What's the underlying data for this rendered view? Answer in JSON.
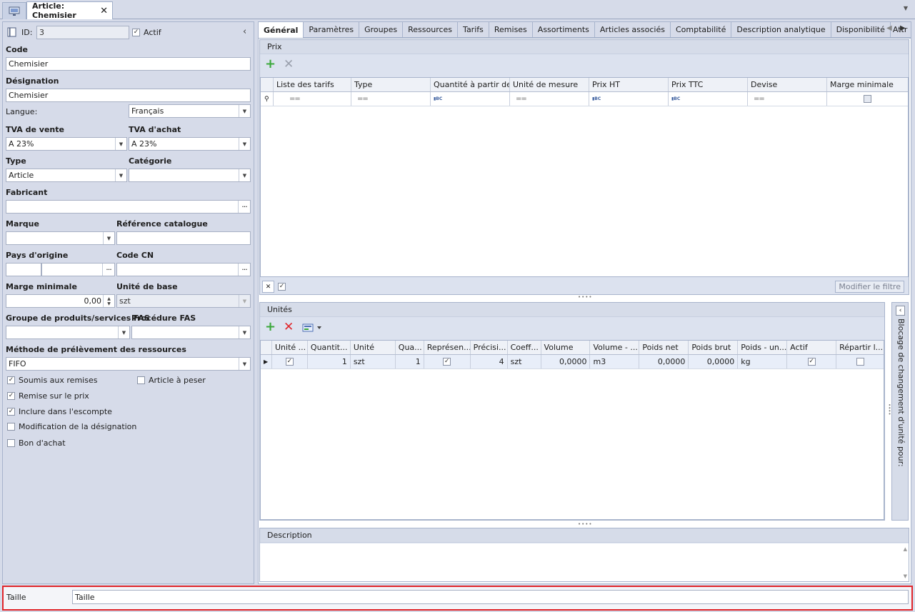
{
  "window": {
    "doc_tab_title": "Article: Chemisier",
    "close_glyph": "✕"
  },
  "form": {
    "id_label": "ID:",
    "id_value": "3",
    "actif_label": "Actif",
    "code_label": "Code",
    "code_value": "Chemisier",
    "designation_label": "Désignation",
    "designation_value": "Chemisier",
    "langue_label": "Langue:",
    "langue_value": "Français",
    "tva_vente_label": "TVA de vente",
    "tva_vente_value": "A 23%",
    "tva_achat_label": "TVA d'achat",
    "tva_achat_value": "A 23%",
    "type_label": "Type",
    "type_value": "Article",
    "categorie_label": "Catégorie",
    "categorie_value": "",
    "fabricant_label": "Fabricant",
    "marque_label": "Marque",
    "ref_catalogue_label": "Référence catalogue",
    "pays_label": "Pays d'origine",
    "code_cn_label": "Code CN",
    "marge_label": "Marge minimale",
    "marge_value": "0,00",
    "unite_base_label": "Unité de base",
    "unite_base_value": "szt",
    "groupe_fas_label": "Groupe de produits/services FAS",
    "procedure_fas_label": "Procédure FAS",
    "methode_label": "Méthode de prélèvement des ressources",
    "methode_value": "FIFO",
    "checks": {
      "soumis": "Soumis aux remises",
      "article_peser": "Article à peser",
      "remise_prix": "Remise sur le prix",
      "escompte": "Inclure dans l'escompte",
      "modif_designation": "Modification de la désignation",
      "bon_achat": "Bon d'achat"
    }
  },
  "tabs": [
    "Général",
    "Paramètres",
    "Groupes",
    "Ressources",
    "Tarifs",
    "Remises",
    "Assortiments",
    "Articles associés",
    "Comptabilité",
    "Description analytique",
    "Disponibilité",
    "Attr"
  ],
  "prix": {
    "title": "Prix",
    "columns": [
      "Liste des tarifs",
      "Type",
      "Quantité à partir de",
      "Unité de mesure",
      "Prix HT",
      "Prix TTC",
      "Devise",
      "Marge minimale"
    ],
    "filter_button": "Modifier le filtre"
  },
  "unites": {
    "title": "Unités",
    "columns": [
      "Unité ...",
      "Quantit...",
      "Unité",
      "Qua...",
      "Représen...",
      "Précisi...",
      "Coeff...",
      "Volume",
      "Volume - ...",
      "Poids net",
      "Poids brut",
      "Poids - un...",
      "Actif",
      "Répartir l..."
    ],
    "row": {
      "quantite": "1",
      "unite": "szt",
      "qua": "1",
      "precision": "4",
      "coeff": "szt",
      "volume": "0,0000",
      "volume_unit": "m3",
      "poids_net": "0,0000",
      "poids_brut": "0,0000",
      "poids_unit": "kg"
    },
    "side_panel_label": "Blocage de changement d'unité pour:"
  },
  "description": {
    "title": "Description"
  },
  "status_bar": {
    "label": "Taille",
    "value": "Taille"
  }
}
